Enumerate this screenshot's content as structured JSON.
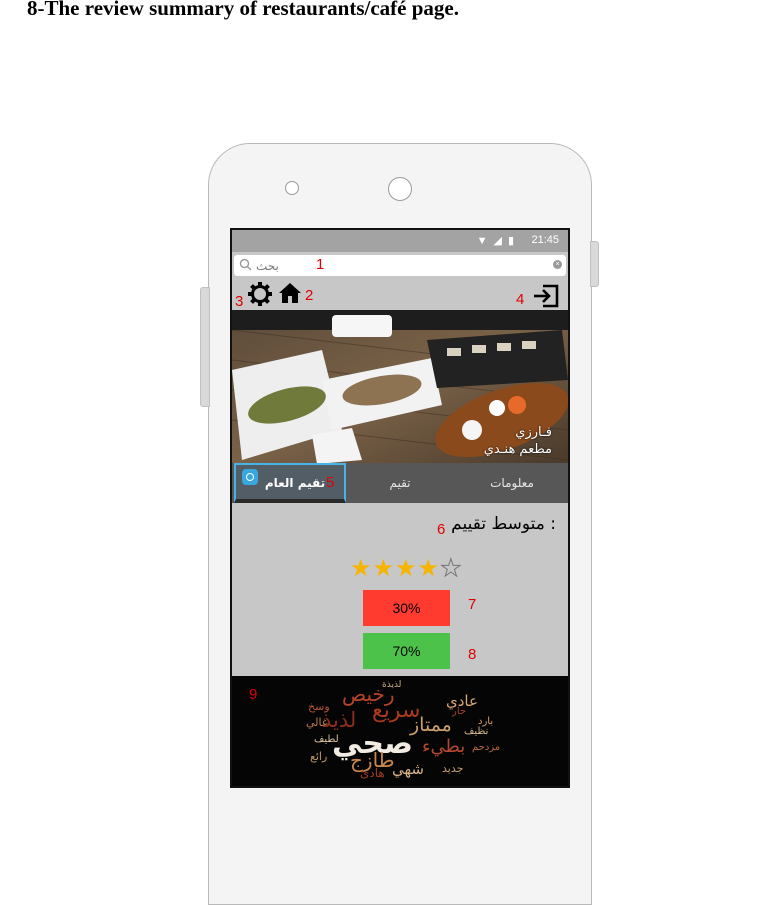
{
  "heading": "8-The review summary of restaurants/café page.",
  "status_bar": {
    "time": "21:45"
  },
  "search": {
    "placeholder": "بحث"
  },
  "markers": [
    "1",
    "2",
    "3",
    "4",
    "5",
    "6",
    "7",
    "8",
    "9"
  ],
  "restaurant": {
    "name": "فـارزي",
    "category": "مطعم هنـدي"
  },
  "tabs": [
    {
      "label": "معلومات",
      "active": false
    },
    {
      "label": "تقيم",
      "active": false
    },
    {
      "label": "تقيم العام",
      "active": true
    }
  ],
  "rating": {
    "label": "متوسط تقييم :",
    "stars_filled": 4,
    "stars_total": 5
  },
  "breakdown": [
    {
      "value": "30%",
      "color": "#ff3b30"
    },
    {
      "value": "70%",
      "color": "#4cc24a"
    }
  ],
  "word_cloud": {
    "words": [
      "رخيص",
      "عادي",
      "سريع",
      "ممتاز",
      "لذيذ",
      "صحي",
      "طازج",
      "بطيء",
      "شهي",
      "هادئ",
      "رائع",
      "غالي",
      "نظيف",
      "مزدحم",
      "جديد",
      "لطيف",
      "حار",
      "بارد",
      "وسخ",
      "لذيذة"
    ]
  },
  "colors": {
    "screen_bg": "#c7c7c7",
    "tab_bar": "#575757",
    "active_tab_border": "#48b3e6",
    "marker": "#e00000"
  }
}
